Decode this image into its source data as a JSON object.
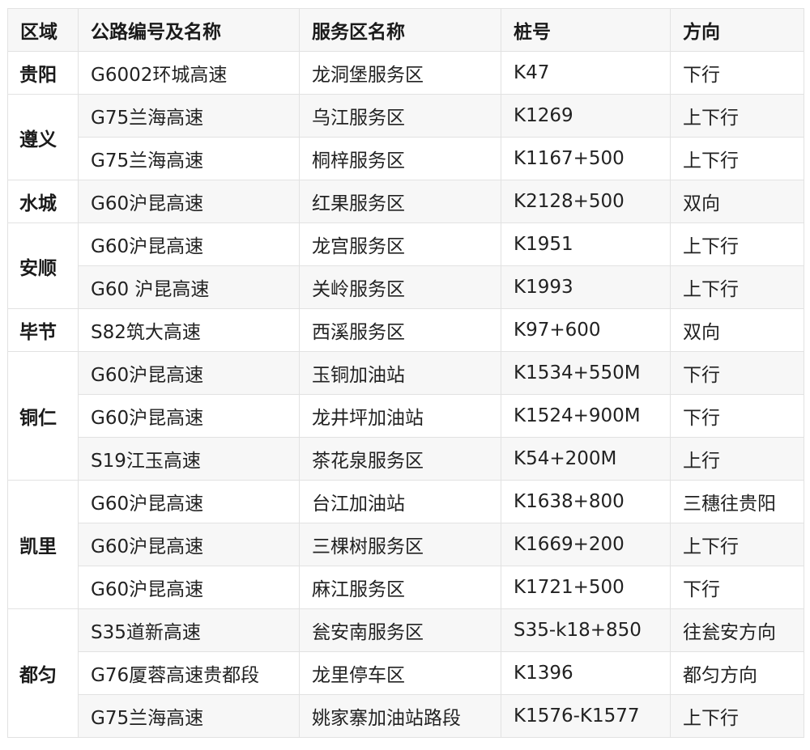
{
  "headers": [
    "区域",
    "公路编号及名称",
    "服务区名称",
    "桩号",
    "方向"
  ],
  "regions": [
    {
      "name": "贵阳",
      "rows": [
        {
          "highway": "G6002环城高速",
          "area": "龙洞堡服务区",
          "stake": "K47",
          "direction": "下行"
        }
      ]
    },
    {
      "name": "遵义",
      "rows": [
        {
          "highway": "G75兰海高速",
          "area": "乌江服务区",
          "stake": "K1269",
          "direction": "上下行"
        },
        {
          "highway": "G75兰海高速",
          "area": "桐梓服务区",
          "stake": "K1167+500",
          "direction": "上下行"
        }
      ]
    },
    {
      "name": "水城",
      "rows": [
        {
          "highway": "G60沪昆高速",
          "area": "红果服务区",
          "stake": "K2128+500",
          "direction": "双向"
        }
      ]
    },
    {
      "name": "安顺",
      "rows": [
        {
          "highway": "G60沪昆高速",
          "area": "龙宫服务区",
          "stake": "K1951",
          "direction": "上下行"
        },
        {
          "highway": "G60 沪昆高速",
          "area": "关岭服务区",
          "stake": "K1993",
          "direction": "上下行"
        }
      ]
    },
    {
      "name": "毕节",
      "rows": [
        {
          "highway": "S82筑大高速",
          "area": "西溪服务区",
          "stake": "K97+600",
          "direction": "双向"
        }
      ]
    },
    {
      "name": "铜仁",
      "rows": [
        {
          "highway": "G60沪昆高速",
          "area": "玉铜加油站",
          "stake": "K1534+550M",
          "direction": "下行"
        },
        {
          "highway": "G60沪昆高速",
          "area": "龙井坪加油站",
          "stake": "K1524+900M",
          "direction": "下行"
        },
        {
          "highway": "S19江玉高速",
          "area": "茶花泉服务区",
          "stake": "K54+200M",
          "direction": "上行"
        }
      ]
    },
    {
      "name": "凯里",
      "rows": [
        {
          "highway": "G60沪昆高速",
          "area": "台江加油站",
          "stake": "K1638+800",
          "direction": "三穗往贵阳"
        },
        {
          "highway": "G60沪昆高速",
          "area": "三棵树服务区",
          "stake": "K1669+200",
          "direction": "上下行"
        },
        {
          "highway": "G60沪昆高速",
          "area": "麻江服务区",
          "stake": "K1721+500",
          "direction": "下行"
        }
      ]
    },
    {
      "name": "都匀",
      "rows": [
        {
          "highway": "S35道新高速",
          "area": "瓮安南服务区",
          "stake": "S35-k18+850",
          "direction": "往瓮安方向"
        },
        {
          "highway": "G76厦蓉高速贵都段",
          "area": "龙里停车区",
          "stake": "K1396",
          "direction": "都匀方向"
        },
        {
          "highway": "G75兰海高速",
          "area": "姚家寨加油站路段",
          "stake": "K1576-K1577",
          "direction": "上下行"
        }
      ]
    }
  ]
}
